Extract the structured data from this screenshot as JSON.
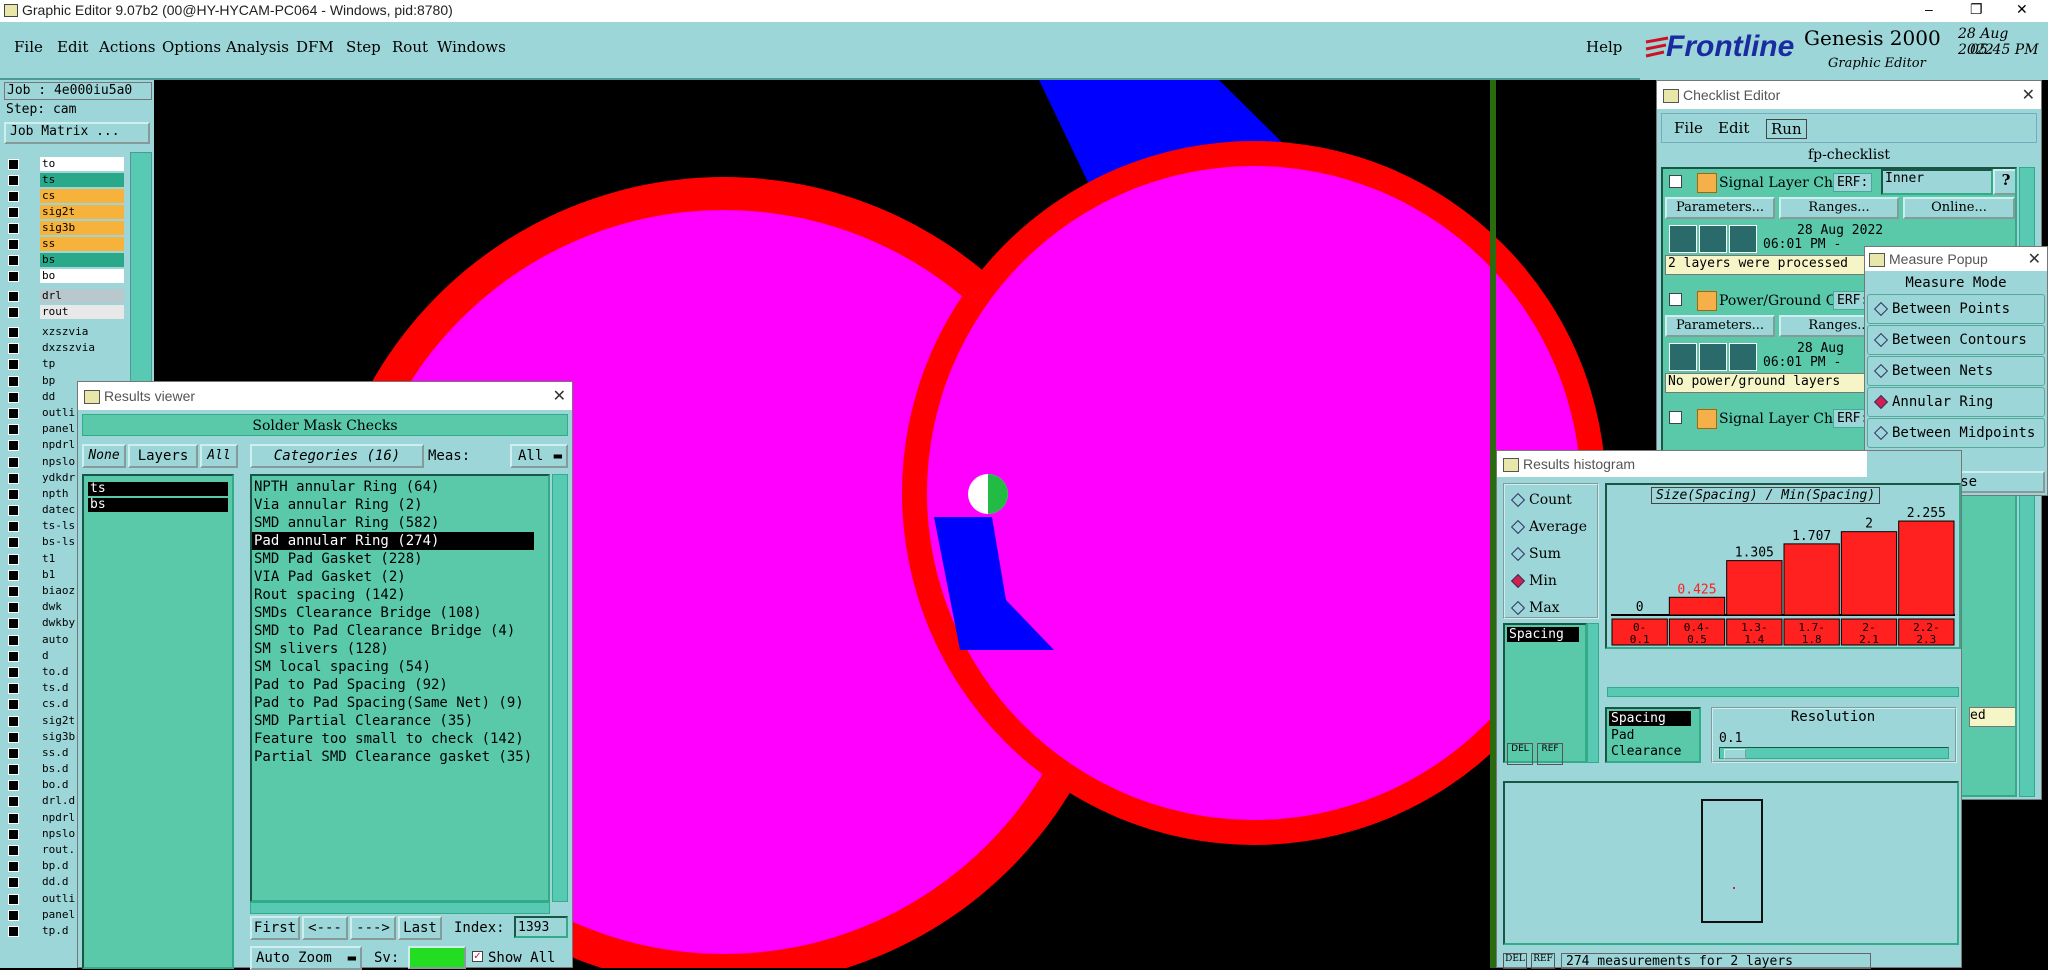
{
  "app": {
    "title": "Graphic Editor 9.07b2 (00@HY-HYCAM-PC064 - Windows, pid:8780)",
    "min": "–",
    "max": "❐",
    "close": "✕"
  },
  "menu": {
    "items": [
      "File",
      "Edit",
      "Actions",
      "Options",
      "Analysis",
      "DFM",
      "Step",
      "Rout",
      "Windows"
    ],
    "help": "Help"
  },
  "brand": {
    "logo": "Frontline",
    "product": "Genesis 2000",
    "subtitle": "Graphic Editor",
    "date": "28 Aug 2022",
    "time": "05:45 PM"
  },
  "job": {
    "job_label": "Job : 4e000iu5a0",
    "step_label": "Step: cam",
    "matrix_button": "Job Matrix ..."
  },
  "layers": {
    "group1": [
      {
        "name": "to",
        "color": "#ffffff"
      },
      {
        "name": "ts",
        "color": "#2aa88a"
      },
      {
        "name": "cs",
        "color": "#f7b23b"
      },
      {
        "name": "sig2t",
        "color": "#f7b23b"
      },
      {
        "name": "sig3b",
        "color": "#f7b23b"
      },
      {
        "name": "ss",
        "color": "#f7b23b"
      },
      {
        "name": "bs",
        "color": "#2aa88a"
      },
      {
        "name": "bo",
        "color": "#ffffff"
      }
    ],
    "group2": [
      {
        "name": "drl",
        "color": "#b8c8cc"
      },
      {
        "name": "rout",
        "color": "#e8e8e8"
      }
    ],
    "group3": [
      "xzszvia",
      "dxzszvia",
      "tp",
      "bp",
      "dd",
      "outli",
      "panel",
      "npdrl",
      "npslo",
      "ydkdr",
      "npth",
      "datec",
      "ts-ls",
      "bs-ls",
      "t1",
      "b1",
      "biaoz",
      "dwk",
      "dwkby",
      "auto",
      "d",
      "to.d",
      "ts.d",
      "cs.d",
      "sig2t",
      "sig3b",
      "ss.d",
      "bs.d",
      "bo.d",
      "drl.d",
      "npdrl",
      "npslo",
      "rout.",
      "bp.d",
      "dd.d",
      "outli",
      "panel",
      "tp.d"
    ]
  },
  "results_viewer": {
    "title": "Results viewer",
    "header": "Solder Mask Checks",
    "none_btn": "None",
    "layers_btn": "Layers",
    "all_btn": "All",
    "layers": [
      "ts",
      "bs"
    ],
    "categories_btn": "Categories (16)",
    "meas_label": "Meas:",
    "meas_value": "All",
    "categories": [
      "NPTH annular Ring (64)",
      "Via annular Ring (2)",
      "SMD annular Ring (582)",
      "Pad annular Ring (274)",
      "SMD Pad Gasket (228)",
      "VIA Pad Gasket (2)",
      "Rout spacing (142)",
      "SMDs Clearance Bridge (108)",
      "SMD to Pad Clearance Bridge (4)",
      "SM slivers (128)",
      "SM local spacing (54)",
      "Pad to Pad Spacing (92)",
      "Pad to Pad Spacing(Same Net) (9)",
      "SMD Partial Clearance (35)",
      "Feature too small to check (142)",
      "Partial SMD Clearance gasket (35)"
    ],
    "selected_index": 3,
    "first_btn": "First",
    "prev_btn": "<---",
    "next_btn": "--->",
    "last_btn": "Last",
    "index_label": "Index:",
    "index_value": "1393",
    "auto_zoom": "Auto Zoom",
    "sv_label": "Sv:",
    "show_all": "Show All"
  },
  "checklist": {
    "title": "Checklist Editor",
    "menu": [
      "File",
      "Edit",
      "Run"
    ],
    "name": "fp-checklist",
    "items": [
      {
        "name": "Signal Layer Ch",
        "erf_label": "ERF:",
        "erf": "Inner",
        "params": "Parameters...",
        "ranges": "Ranges...",
        "online": "Online...",
        "date": "28 Aug 2022",
        "time": "06:01 PM -",
        "status": "2 layers were processed"
      },
      {
        "name": "Power/Ground C",
        "erf_label": "ERF:",
        "erf": "",
        "params": "Parameters...",
        "ranges": "Ranges...",
        "online": "",
        "date": "28 Aug",
        "time": "06:01 PM -",
        "status": "No power/ground layers"
      },
      {
        "name": "Signal Layer Ch",
        "erf_label": "ERF:",
        "erf": "",
        "params": "",
        "ranges": "",
        "online": "",
        "date": "",
        "time": "",
        "status": ""
      }
    ],
    "help": "?",
    "side_text": [
      "ed"
    ]
  },
  "measure_popup": {
    "title": "Measure Popup",
    "mode_label": "Measure Mode",
    "modes": [
      "Between Points",
      "Between Contours",
      "Between Nets",
      "Annular Ring",
      "Between Midpoints"
    ],
    "selected": 3,
    "close": "Close"
  },
  "histogram": {
    "title": "Results histogram",
    "stats": [
      "Count",
      "Average",
      "Sum",
      "Min",
      "Max"
    ],
    "selected_stat": 3,
    "left_list": [
      "Spacing"
    ],
    "chart_title": "Size(Spacing) / Min(Spacing)",
    "types": [
      "Spacing",
      "Pad",
      "Clearance"
    ],
    "resolution_label": "Resolution",
    "resolution_value": "0.1",
    "footer": "274 measurements for 2 layers",
    "del": "DEL",
    "ref": "REF"
  },
  "chart_data": {
    "type": "bar",
    "title": "Size(Spacing) / Min(Spacing)",
    "categories": [
      "0-0.1",
      "0.4-0.5",
      "1.3-1.4",
      "1.7-1.8",
      "2-2.1",
      "2.2-2.3"
    ],
    "values": [
      0,
      0.425,
      1.305,
      1.707,
      2,
      2.255
    ],
    "labels": [
      "0",
      "0.425",
      "1.305",
      "1.707",
      "2",
      "2.255"
    ],
    "bar_color": "#ff2020",
    "highlight_label_color": "#ff2020",
    "ylim": [
      0,
      2.4
    ]
  },
  "colors": {
    "canvas": "#000000",
    "pad_fill": "#ff00ff",
    "pad_ring": "#ff0000",
    "trace": "#0000ff",
    "ui_teal": "#9dd6d8",
    "ui_mint": "#59c9aa"
  }
}
